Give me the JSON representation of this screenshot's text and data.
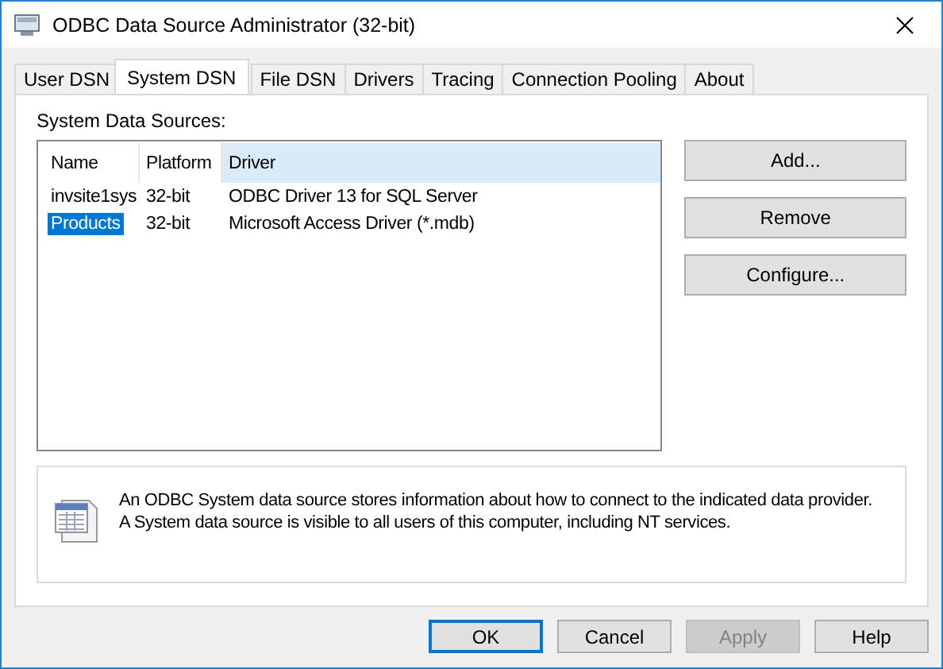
{
  "window": {
    "title": "ODBC Data Source Administrator (32-bit)"
  },
  "tabs": [
    {
      "label": "User DSN",
      "selected": false
    },
    {
      "label": "System DSN",
      "selected": true
    },
    {
      "label": "File DSN",
      "selected": false
    },
    {
      "label": "Drivers",
      "selected": false
    },
    {
      "label": "Tracing",
      "selected": false
    },
    {
      "label": "Connection Pooling",
      "selected": false
    },
    {
      "label": "About",
      "selected": false
    }
  ],
  "list_label": "System Data Sources:",
  "table": {
    "columns": [
      {
        "label": "Name",
        "highlighted": false
      },
      {
        "label": "Platform",
        "highlighted": false
      },
      {
        "label": "Driver",
        "highlighted": true
      }
    ],
    "rows": [
      {
        "cells": [
          "invsite1sys",
          "32-bit",
          "ODBC Driver 13 for SQL Server"
        ],
        "selected": false
      },
      {
        "cells": [
          "Products",
          "32-bit",
          "Microsoft Access Driver (*.mdb)"
        ],
        "selected": true
      }
    ]
  },
  "side_buttons": [
    {
      "label": "Add..."
    },
    {
      "label": "Remove"
    },
    {
      "label": "Configure..."
    }
  ],
  "info_text": [
    "An ODBC System data source stores information about how to connect to the indicated data provider.",
    "A System data source is visible to all users of this computer, including NT services."
  ],
  "buttons": [
    {
      "label": "OK",
      "default": true,
      "disabled": false
    },
    {
      "label": "Cancel",
      "default": false,
      "disabled": false
    },
    {
      "label": "Apply",
      "default": false,
      "disabled": true
    },
    {
      "label": "Help",
      "default": false,
      "disabled": false
    }
  ]
}
